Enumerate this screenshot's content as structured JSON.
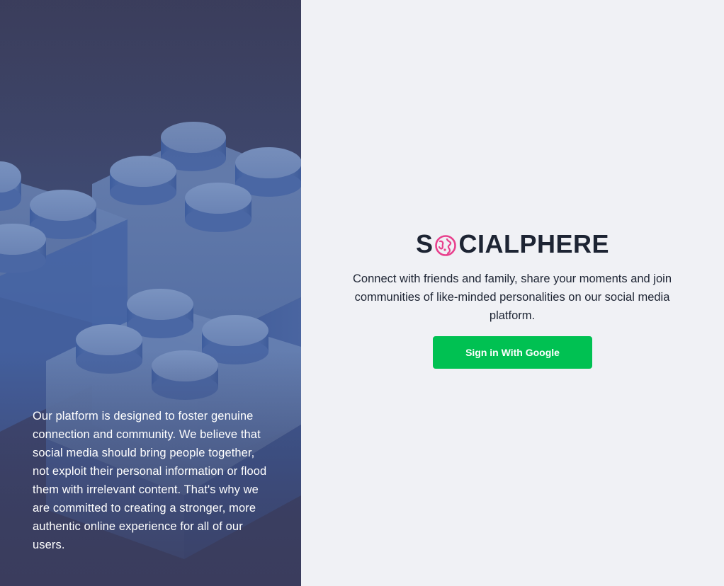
{
  "left_panel": {
    "image_description_icon": "lego-bricks-image",
    "mission_text": "Our platform is designed to foster genuine connection and community. We believe that social media should bring people together, not exploit their personal information or flood them with irrelevant content. That's why we are committed to creating a stronger, more authentic online experience for all of our users."
  },
  "brand": {
    "prefix": "S",
    "logo_icon": "globe-icon",
    "suffix": "CIALPHERE",
    "logo_color": "#e8408d"
  },
  "tagline": "Connect with friends and family, share your moments and join communities of like-minded personalities on our social media platform.",
  "signin": {
    "button_label": "Sign in With Google",
    "button_color": "#00c152"
  }
}
